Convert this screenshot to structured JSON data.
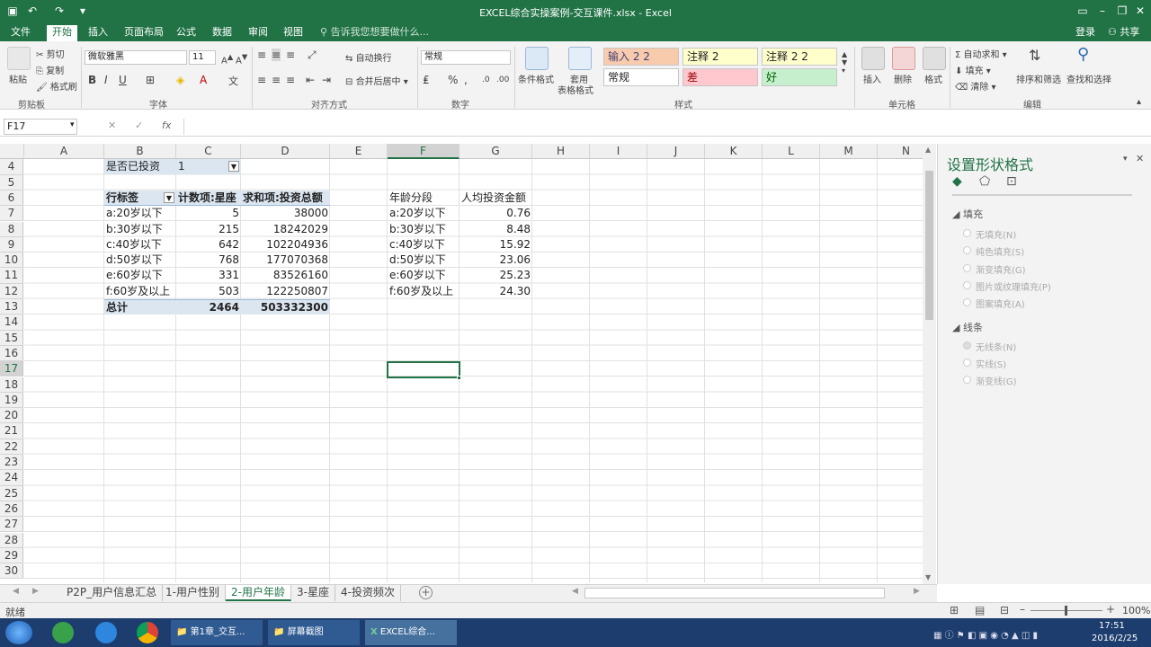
{
  "window": {
    "title": "EXCEL综合实操案例-交互课件.xlsx - Excel",
    "login": "登录",
    "share": "共享"
  },
  "menu": [
    "文件",
    "开始",
    "插入",
    "页面布局",
    "公式",
    "数据",
    "审阅",
    "视图"
  ],
  "tell_me": "告诉我您想要做什么...",
  "ribbon": {
    "paste": "粘贴",
    "cut": "剪切",
    "copy": "复制",
    "format_painter": "格式刷",
    "clipboard_group": "剪贴板",
    "font_name": "微软雅黑",
    "font_size": "11",
    "font_group": "字体",
    "wrap": "自动换行",
    "merge": "合并后居中",
    "align_group": "对齐方式",
    "num_format": "常规",
    "number_group": "数字",
    "cond_format": "条件格式",
    "table_format": "套用",
    "table_format2": "表格格式",
    "styles": [
      {
        "label": "输入 2 2",
        "bg": "#f8cbad",
        "color": "#3f3f76"
      },
      {
        "label": "注释 2",
        "bg": "#ffffcc",
        "color": "#222"
      },
      {
        "label": "注释 2 2",
        "bg": "#ffffcc",
        "color": "#222"
      },
      {
        "label": "常规",
        "bg": "#ffffff",
        "color": "#222"
      },
      {
        "label": "差",
        "bg": "#ffc7ce",
        "color": "#9c0006"
      },
      {
        "label": "好",
        "bg": "#c6efce",
        "color": "#006100"
      }
    ],
    "styles_group": "样式",
    "insert": "插入",
    "delete": "删除",
    "format": "格式",
    "cells_group": "单元格",
    "autosum": "自动求和",
    "fill": "填充",
    "clear": "清除",
    "sort": "排序和筛选",
    "find": "查找和选择",
    "edit_group": "编辑"
  },
  "formula_bar": {
    "name_box": "F17",
    "fx": "fx",
    "value": ""
  },
  "columns": [
    "A",
    "B",
    "C",
    "D",
    "E",
    "F",
    "G",
    "H",
    "I",
    "J",
    "K",
    "L",
    "M",
    "N"
  ],
  "rows": [
    "4",
    "5",
    "6",
    "7",
    "8",
    "9",
    "10",
    "11",
    "12",
    "13",
    "14",
    "15",
    "16",
    "17",
    "18",
    "19",
    "20",
    "21",
    "22",
    "23",
    "24",
    "25",
    "26",
    "27",
    "28",
    "29",
    "30"
  ],
  "pivot": {
    "filter_label": "是否已投资",
    "filter_value": "1",
    "headers": [
      "行标签",
      "计数项:星座",
      "求和项:投资总额"
    ],
    "rows": [
      [
        "a:20岁以下",
        "5",
        "38000"
      ],
      [
        "b:30岁以下",
        "215",
        "18242029"
      ],
      [
        "c:40岁以下",
        "642",
        "102204936"
      ],
      [
        "d:50岁以下",
        "768",
        "177070368"
      ],
      [
        "e:60岁以下",
        "331",
        "83526160"
      ],
      [
        "f:60岁及以上",
        "503",
        "122250807"
      ]
    ],
    "total": [
      "总计",
      "2464",
      "503332300"
    ]
  },
  "side_table": {
    "headers": [
      "年龄分段",
      "人均投资金额"
    ],
    "rows": [
      [
        "a:20岁以下",
        "0.76"
      ],
      [
        "b:30岁以下",
        "8.48"
      ],
      [
        "c:40岁以下",
        "15.92"
      ],
      [
        "d:50岁以下",
        "23.06"
      ],
      [
        "e:60岁以下",
        "25.23"
      ],
      [
        "f:60岁及以上",
        "24.30"
      ]
    ]
  },
  "pane": {
    "title": "设置形状格式",
    "fill_section": "填充",
    "fill_opts": [
      "无填充(N)",
      "纯色填充(S)",
      "渐变填充(G)",
      "图片或纹理填充(P)",
      "图案填充(A)"
    ],
    "line_section": "线条",
    "line_opts": [
      "无线条(N)",
      "实线(S)",
      "渐变线(G)"
    ]
  },
  "sheets": [
    "P2P_用户信息汇总",
    "1-用户性别",
    "2-用户年龄",
    "3-星座",
    "4-投资频次"
  ],
  "status": {
    "ready": "就绪",
    "zoom": "100%"
  },
  "taskbar": {
    "items": [
      "第1章_交互...",
      "屏幕截图",
      "EXCEL综合..."
    ],
    "time": "17:51",
    "date": "2016/2/25"
  }
}
